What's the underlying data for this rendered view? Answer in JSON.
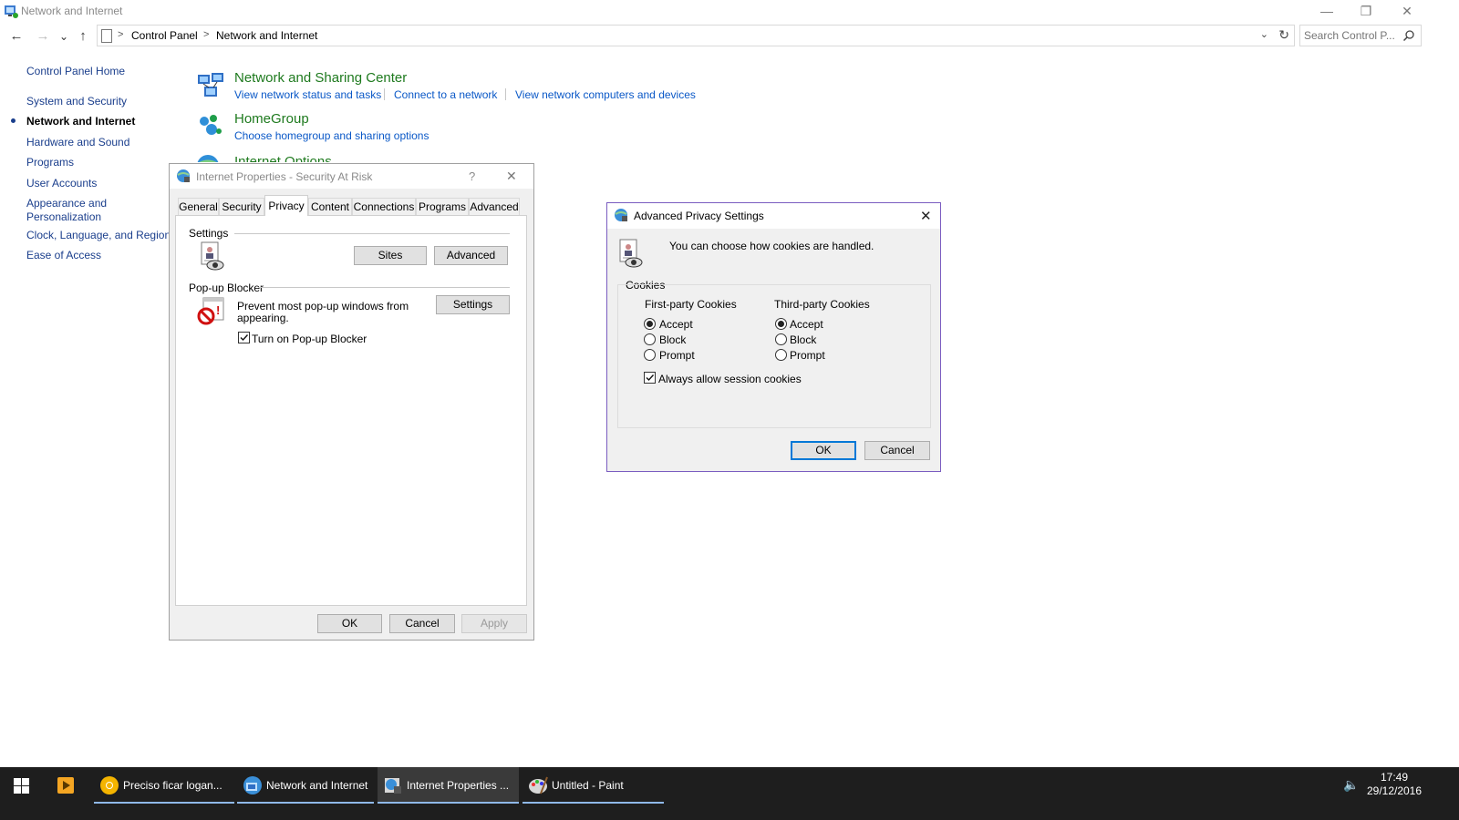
{
  "window": {
    "title": "Network and Internet",
    "minimize": "—",
    "maximize": "❐",
    "close": "✕"
  },
  "address": {
    "back": "←",
    "forward": "→",
    "recent": "⌄",
    "up": "↑",
    "root_sep": ">",
    "crumbs": [
      "Control Panel",
      "Network and Internet"
    ],
    "crumb_sep": ">",
    "dropdown": "⌄",
    "refresh": "↻"
  },
  "search": {
    "placeholder": "Search Control P..."
  },
  "leftnav": {
    "items": [
      {
        "label": "Control Panel Home"
      },
      {
        "label": "System and Security"
      },
      {
        "label": "Network and Internet"
      },
      {
        "label": "Hardware and Sound"
      },
      {
        "label": "Programs"
      },
      {
        "label": "User Accounts"
      },
      {
        "label": "Appearance and"
      },
      {
        "label": "Personalization"
      },
      {
        "label": "Clock, Language, and Region"
      },
      {
        "label": "Ease of Access"
      }
    ]
  },
  "main": {
    "network_center": {
      "title": "Network and Sharing Center",
      "links": [
        "View network status and tasks",
        "Connect to a network",
        "View network computers and devices"
      ]
    },
    "homegroup": {
      "title": "HomeGroup",
      "link": "Choose homegroup and sharing options"
    },
    "internet_options": {
      "title": "Internet Options"
    }
  },
  "internet_properties": {
    "title": "Internet Properties - Security At Risk",
    "help": "?",
    "close": "✕",
    "tabs": [
      "General",
      "Security",
      "Privacy",
      "Content",
      "Connections",
      "Programs",
      "Advanced"
    ],
    "active_tab": "Privacy",
    "settings_label": "Settings",
    "sites_button": "Sites",
    "advanced_button": "Advanced",
    "popup_label": "Pop-up Blocker",
    "popup_text_1": "Prevent most pop-up windows from",
    "popup_text_2": "appearing.",
    "popup_settings_button": "Settings",
    "popup_checkbox_label": "Turn on Pop-up Blocker",
    "popup_checked": true,
    "ok": "OK",
    "cancel": "Cancel",
    "apply": "Apply"
  },
  "advanced_privacy": {
    "title": "Advanced Privacy Settings",
    "close": "✕",
    "description": "You can choose how cookies are handled.",
    "cookies_label": "Cookies",
    "first_party_label": "First-party Cookies",
    "third_party_label": "Third-party Cookies",
    "options": [
      "Accept",
      "Block",
      "Prompt"
    ],
    "first_party_selected": "Accept",
    "third_party_selected": "Accept",
    "session_label": "Always allow session cookies",
    "session_checked": true,
    "ok": "OK",
    "cancel": "Cancel"
  },
  "taskbar": {
    "items": [
      {
        "label": "Preciso ficar logan...",
        "icon": "chrome-icon",
        "active": false
      },
      {
        "label": "Network and Internet",
        "icon": "control-panel-icon",
        "active": false
      },
      {
        "label": "Internet Properties ...",
        "icon": "internet-properties-icon",
        "active": true
      },
      {
        "label": "Untitled - Paint",
        "icon": "paint-icon",
        "active": false
      }
    ],
    "volume": "🔈",
    "time": "17:49",
    "date": "29/12/2016"
  },
  "colors": {
    "link": "#0a58c7",
    "category_title": "#1e7a1e",
    "nav_link": "#1a3e8c",
    "dialog_bg": "#f0f0f0",
    "taskbar_bg": "#1e1e1e",
    "focus_border": "#7a5cc0"
  }
}
